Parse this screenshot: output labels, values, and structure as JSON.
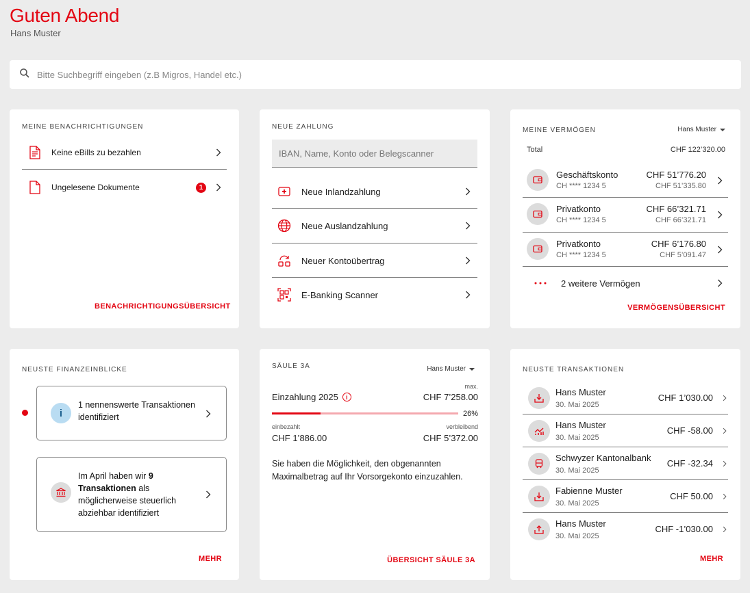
{
  "header": {
    "greeting": "Guten Abend",
    "user_name": "Hans Muster"
  },
  "search": {
    "placeholder": "Bitte Suchbegriff eingeben (z.B Migros, Handel etc.)"
  },
  "notifications": {
    "title": "MEINE BENACHRICHTIGUNGEN",
    "items": [
      {
        "label": "Keine eBills zu bezahlen",
        "icon": "bill-document-icon"
      },
      {
        "label": "Ungelesene Dokumente",
        "icon": "document-icon",
        "badge": "1"
      }
    ],
    "link": "BENACHRICHTIGUNGSÜBERSICHT"
  },
  "payment": {
    "title": "NEUE ZAHLUNG",
    "placeholder": "IBAN, Name, Konto oder Belegscanner",
    "items": [
      {
        "label": "Neue Inlandzahlung",
        "icon": "swiss-cross-icon"
      },
      {
        "label": "Neue Auslandzahlung",
        "icon": "globe-icon"
      },
      {
        "label": "Neuer Kontoübertrag",
        "icon": "transfer-icon"
      },
      {
        "label": "E-Banking Scanner",
        "icon": "qr-scanner-icon"
      }
    ]
  },
  "assets": {
    "title": "MEINE VERMÖGEN",
    "owner": "Hans Muster",
    "total_label": "Total",
    "total_value": "CHF 122’320.00",
    "accounts": [
      {
        "name": "Geschäftskonto",
        "iban": "CH **** 1234 5",
        "amount": "CHF 51’776.20",
        "amount_secondary": "CHF 51’335.80"
      },
      {
        "name": "Privatkonto",
        "iban": "CH **** 1234 5",
        "amount": "CHF 66’321.71",
        "amount_secondary": "CHF 66’321.71"
      },
      {
        "name": "Privatkonto",
        "iban": "CH **** 1234 5",
        "amount": "CHF 6’176.80",
        "amount_secondary": "CHF 5’091.47"
      }
    ],
    "more_label": "2 weitere Vermögen",
    "link": "VERMÖGENSÜBERSICHT"
  },
  "insights": {
    "title": "NEUSTE FINANZEINBLICKE",
    "items": [
      {
        "text_parts": [
          "1 nennenswerte Transaktionen identifiziert"
        ],
        "icon": "info-icon"
      },
      {
        "text_a": "Im April haben wir ",
        "text_b": "9 Transaktionen",
        "text_c": " als möglicherweise steuerlich abziehbar identifiziert",
        "icon": "bank-icon"
      }
    ],
    "link": "MEHR"
  },
  "pillar3a": {
    "title": "SÄULE 3A",
    "owner": "Hans Muster",
    "max_label": "max.",
    "deposit_label": "Einzahlung 2025",
    "max_value": "CHF 7’258.00",
    "progress": 0.26,
    "progress_label": "26%",
    "paid_label": "einbezahlt",
    "paid_value": "CHF 1’886.00",
    "remaining_label": "verbleibend",
    "remaining_value": "CHF 5’372.00",
    "info_text": "Sie haben die Möglichkeit, den obgenannten Maximalbetrag auf Ihr Vorsorgekonto einzuzahlen.",
    "link": "ÜBERSICHT SÄULE 3A"
  },
  "transactions": {
    "title": "NEUSTE TRANSAKTIONEN",
    "items": [
      {
        "name": "Hans Muster",
        "date": "30. Mai 2025",
        "amount": "CHF 1’030.00",
        "icon": "incoming-icon"
      },
      {
        "name": "Hans Muster",
        "date": "30. Mai 2025",
        "amount": "CHF -58.00",
        "icon": "investment-chart-icon"
      },
      {
        "name": "Schwyzer Kantonalbank",
        "date": "30. Mai 2025",
        "amount": "CHF -32.34",
        "icon": "train-icon"
      },
      {
        "name": "Fabienne Muster",
        "date": "30. Mai 2025",
        "amount": "CHF 50.00",
        "icon": "incoming-icon"
      },
      {
        "name": "Hans Muster",
        "date": "30. Mai 2025",
        "amount": "CHF -1’030.00",
        "icon": "outgoing-icon"
      }
    ],
    "link": "MEHR"
  },
  "colors": {
    "accent": "#e30613",
    "background": "#ececec",
    "card": "#ffffff"
  }
}
